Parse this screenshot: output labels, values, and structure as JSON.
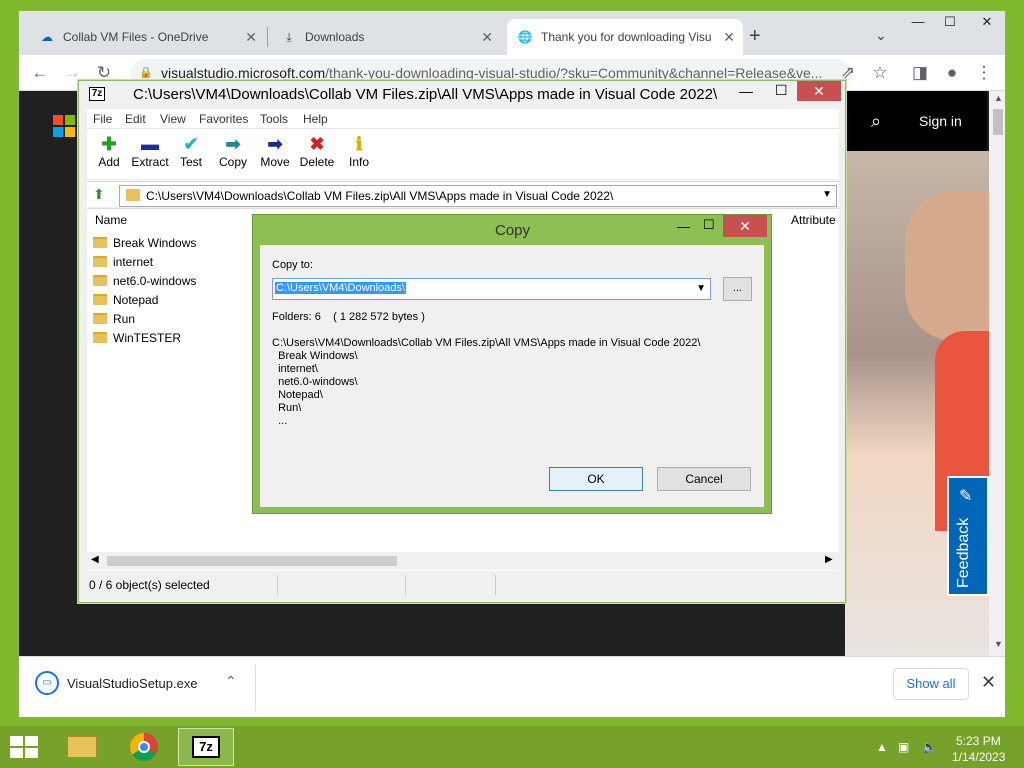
{
  "browser": {
    "tabs": [
      {
        "label": "Collab VM Files - OneDrive",
        "icon": "cloud-icon"
      },
      {
        "label": "Downloads",
        "icon": "download-icon"
      },
      {
        "label": "Thank you for downloading Visu",
        "icon": "globe-icon"
      }
    ],
    "url_host": "visualstudio.microsoft.com",
    "url_path": "/thank-you-downloading-visual-studio/?sku=Community&channel=Release&ve..."
  },
  "site": {
    "signin": "Sign in",
    "feedback": "Feedback"
  },
  "download_bar": {
    "file": "VisualStudioSetup.exe",
    "show_all": "Show all"
  },
  "sevenzip": {
    "title": "C:\\Users\\VM4\\Downloads\\Collab VM Files.zip\\All VMS\\Apps made in Visual Code 2022\\",
    "menu": [
      "File",
      "Edit",
      "View",
      "Favorites",
      "Tools",
      "Help"
    ],
    "toolbar": [
      {
        "label": "Add",
        "icon": "add-icon"
      },
      {
        "label": "Extract",
        "icon": "extract-icon"
      },
      {
        "label": "Test",
        "icon": "test-icon"
      },
      {
        "label": "Copy",
        "icon": "copy-icon"
      },
      {
        "label": "Move",
        "icon": "move-icon"
      },
      {
        "label": "Delete",
        "icon": "delete-icon"
      },
      {
        "label": "Info",
        "icon": "info-icon"
      }
    ],
    "address": "C:\\Users\\VM4\\Downloads\\Collab VM Files.zip\\All VMS\\Apps made in Visual Code 2022\\",
    "columns": {
      "name": "Name",
      "attributes": "Attribute"
    },
    "files": [
      "Break Windows",
      "internet",
      "net6.0-windows",
      "Notepad",
      "Run",
      "WinTESTER"
    ],
    "status": "0 / 6 object(s) selected"
  },
  "copy_dialog": {
    "title": "Copy",
    "copy_to_label": "Copy to:",
    "destination": "C:\\Users\\VM4\\Downloads\\",
    "browse": "...",
    "info": "Folders: 6    ( 1 282 572 bytes )",
    "source": "C:\\Users\\VM4\\Downloads\\Collab VM Files.zip\\All VMS\\Apps made in Visual Code 2022\\\n  Break Windows\\\n  internet\\\n  net6.0-windows\\\n  Notepad\\\n  Run\\\n  ...",
    "ok": "OK",
    "cancel": "Cancel"
  },
  "taskbar": {
    "time": "5:23 PM",
    "date": "1/14/2023"
  }
}
